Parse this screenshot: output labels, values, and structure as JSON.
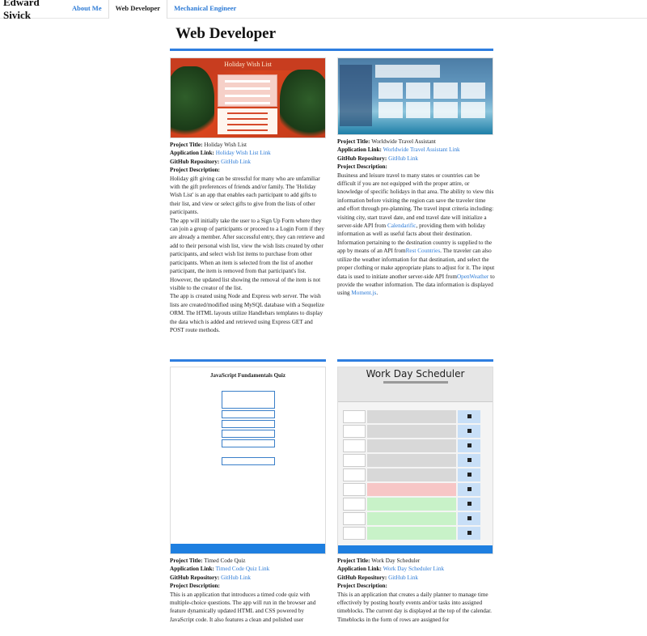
{
  "navbar": {
    "brand": "Edward Sivick",
    "links": [
      "About Me",
      "Web Developer",
      "Mechanical Engineer"
    ]
  },
  "page": {
    "title": "Web Developer"
  },
  "labels": {
    "project_title": "Project Title:",
    "application_link": "Application Link:",
    "github_repository": "GitHub Repository:",
    "project_description": "Project Description:"
  },
  "projects": [
    {
      "title": "Holiday Wish List",
      "app_link": "Holiday Wish List Link",
      "repo_link": "GitHub Link",
      "screenshot": {
        "banner": "Holiday Wish List"
      },
      "description": [
        "Holiday gift giving can be stressful for many who are unfamiliar with the gift preferences of friends and/or family. The 'Holiday Wish List' is an app that enables each participant to add gifts to their list, and view or select gifts to give from the lists of other participants.",
        "The app will initially take the user to a Sign Up Form where they can join a group of participants or proceed to a Login Form if they are already a member. After successful entry, they can retrieve and add to their personal wish list, view the wish lists created by other participants, and select wish list items to purchase from other participants. When an item is selected from the list of another participant, the item is removed from that participant's list. However, the updated list showing the removal of the item is not visible to the creator of the list.",
        "The app is created using Node and Express web server. The wish lists are created/modified using MySQL database with a Sequelize ORM. The HTML layouts utilize Handlebars templates to display the data which is added and retrieved using Express GET and POST route methods."
      ]
    },
    {
      "title": "Worldwide Travel Assistant",
      "app_link": "Worldwide Travel Assistant Link",
      "repo_link": "GitHub Link",
      "description_parts": {
        "p1": "Business and leisure travel to many states or countries can be difficult if you are not equipped with the proper attire, or knowledge of specific holidays in that area. The ability to view this information before visiting the region can save the traveler time and effort through pre-planning. The travel input criteria including: visiting city, start travel date, and end travel date will initialize a server-side API from ",
        "link1": "Calendarific",
        "p2": ", providing them with holiday information as well as useful facts about their destination. Information pertaining to the destination country is supplied to the app by means of an API from",
        "link2": "Rest Countries",
        "p3": ". The traveler can also utilize the weather information for that destination, and select the proper clothing or make appropriate plans to adjust for it. The input data is used to initiate another server-side API from",
        "link3": "OpenWeather",
        "p4": " to provide the weather information. The data information is displayed using ",
        "link4": "Moment.js",
        "p5": "."
      }
    },
    {
      "title": "Timed Code Quiz",
      "app_link": "Timed Code Quiz Link",
      "repo_link": "GitHub Link",
      "screenshot": {
        "title": "JavaScript Fundamentals Quiz"
      },
      "description": "This is an application that introduces a timed code quiz with multiple-choice questions. The app will run in the browser and feature dynamically updated HTML and CSS powered by JavaScript code. It also features a clean and polished user"
    },
    {
      "title": "Work Day Scheduler",
      "app_link": "Work Day Scheduler Link",
      "repo_link": "GitHub Link",
      "screenshot": {
        "title": "Work Day Scheduler"
      },
      "description": "This is an application that creates a daily planner to manage time effectively by posting hourly events and/or tasks into assigned timeblocks. The current day is displayed at the top of the calendar. Timeblocks in the form of rows are assigned for"
    }
  ]
}
